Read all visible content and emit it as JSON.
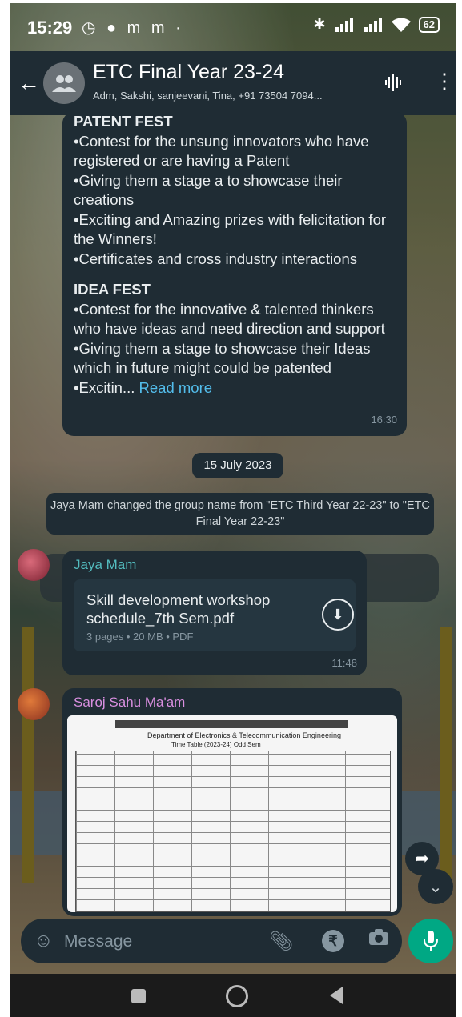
{
  "status_bar": {
    "time": "15:29",
    "left_icons": "◷ ● m m ·",
    "battery": "62"
  },
  "header": {
    "title": "ETC Final Year 23-24",
    "subtitle": "Adm, Sakshi, sanjeevani, Tina, +91 73504 7094..."
  },
  "messages": {
    "announcement": {
      "patent_heading": "PATENT FEST",
      "patent_lines": [
        "•Contest for the unsung innovators who have registered or are having a Patent",
        "•Giving them a stage a to showcase their creations",
        "•Exciting and Amazing prizes with felicitation for the Winners!",
        "•Certificates and cross industry interactions"
      ],
      "idea_heading": "IDEA FEST",
      "idea_lines": [
        "•Contest for the innovative & talented thinkers  who have ideas and need direction and support",
        "•Giving them a stage to showcase their Ideas which in future might could be patented"
      ],
      "truncated_text": "•Excitin... ",
      "read_more": "Read more",
      "time": "16:30"
    },
    "date_chip": "15 July 2023",
    "system_message": "Jaya Mam changed the group name from \"ETC Third Year 22-23\" to \"ETC Final Year 22-23\"",
    "document_message": {
      "sender": "Jaya Mam",
      "filename": "Skill development workshop schedule_7th Sem.pdf",
      "meta": "3 pages • 20 MB • PDF",
      "time": "11:48"
    },
    "image_message": {
      "sender": "Saroj Sahu Ma'am",
      "doc_title": "Department of Electronics & Telecommunication Engineering",
      "doc_subtitle": "Time Table (2023-24) Odd Sem"
    }
  },
  "input": {
    "placeholder": "Message",
    "rupee_symbol": "₹"
  },
  "colors": {
    "bubble": "#1f2c34",
    "accent_green": "#00a884",
    "link_blue": "#53bdeb"
  }
}
